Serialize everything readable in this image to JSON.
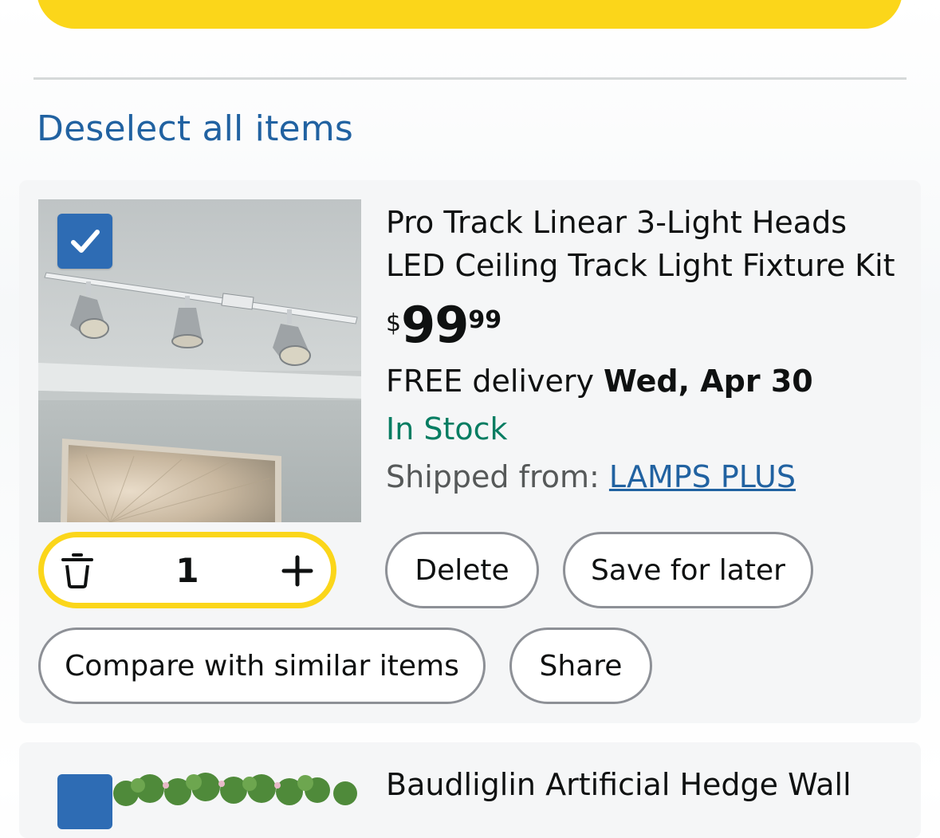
{
  "deselect_all": "Deselect all items",
  "item": {
    "title": "Pro Track Linear 3-Light Heads LED Ceiling Track Light Fixture Kit",
    "price": {
      "symbol": "$",
      "whole": "99",
      "fraction": "99"
    },
    "delivery": {
      "prefix": "FREE delivery",
      "date": "Wed, Apr 30"
    },
    "stock": "In Stock",
    "shipped_from": {
      "label": "Shipped from:",
      "seller": "LAMPS PLUS"
    },
    "quantity": "1",
    "selected": true,
    "actions": {
      "delete": "Delete",
      "save_for_later": "Save for later",
      "compare": "Compare with similar items",
      "share": "Share"
    }
  },
  "next_item": {
    "title": "Baudliglin Artificial Hedge Wall"
  },
  "colors": {
    "accent_yellow": "#fbd61a",
    "link_blue": "#2162a1",
    "stock_green": "#067d62",
    "checkbox_blue": "#2e6cb4"
  },
  "icons": {
    "checkbox": "checkmark-icon",
    "qty_delete": "trash-icon",
    "qty_increase": "plus-icon"
  }
}
